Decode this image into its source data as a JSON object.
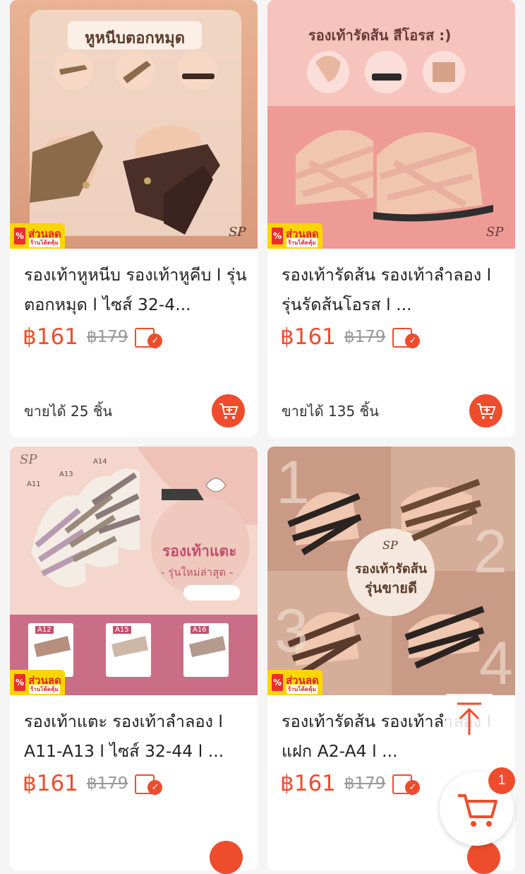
{
  "colors": {
    "accent": "#ee4d2d",
    "badge_yellow": "#ffd500"
  },
  "badge": {
    "main": "ส่วนลด",
    "sub": "ร้านโค้ดคุ้ม",
    "percent": "%"
  },
  "products": [
    {
      "title": "รองเท้าหูหนีบ รองเท้าหูคีบ l รุ่นตอกหมุด l ไซส์ 32-4...",
      "price": "฿161",
      "old_price": "฿179",
      "sold": "ขายได้ 25 ชิ้น",
      "image": {
        "headline": "หูหนีบตอกหมุด",
        "brand": "SP"
      }
    },
    {
      "title": "รองเท้ารัดส้น รองเท้าลำลอง l รุ่นรัดส้นโอรส l ...",
      "price": "฿161",
      "old_price": "฿179",
      "sold": "ขายได้ 135 ชิ้น",
      "image": {
        "headline": "รองเท้ารัดส้น สีโอรส :)",
        "brand": "SP"
      }
    },
    {
      "title": "รองเท้าแตะ รองเท้าลำลอง l A11-A13 l ไซส์ 32-44 l ...",
      "price": "฿161",
      "old_price": "฿179",
      "image": {
        "headline": "รองเท้าแตะ",
        "subline": "- รุ่นใหม่ล่าสุด -",
        "brand": "SP",
        "labels": [
          "A11",
          "A13",
          "A14",
          "A12",
          "A15",
          "A16"
        ]
      }
    },
    {
      "title": "รองเท้ารัดส้น รองเท้าลำลอง l แฝก A2-A4 l ...",
      "price": "฿161",
      "old_price": "฿179",
      "image": {
        "headline": "รองเท้ารัดส้น",
        "subline": "รุ่นขายดี",
        "brand": "SP",
        "numbers": [
          "1",
          "2",
          "3",
          "4"
        ]
      }
    }
  ],
  "floating": {
    "cart_count": "1"
  },
  "icons": {
    "cart": "cart-plus-icon",
    "scroll_top": "arrow-up-icon",
    "cod": "cod-badge-icon"
  }
}
